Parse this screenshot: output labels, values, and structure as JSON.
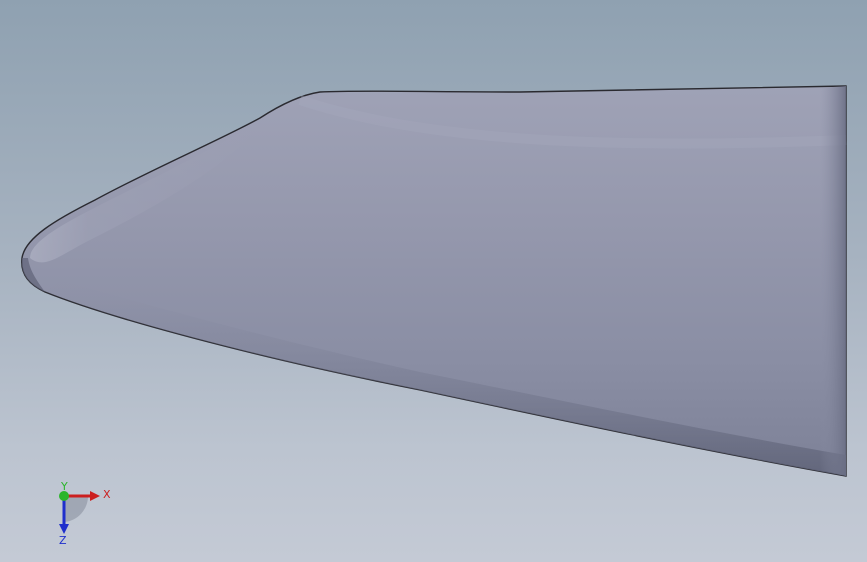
{
  "viewport": {
    "background_top": "#8fa1b1",
    "background_bottom": "#c4cad5"
  },
  "model": {
    "fill_light": "#9da0b5",
    "fill_mid": "#8e92a8",
    "fill_dark": "#6f7389",
    "edge_color": "#2a2a30"
  },
  "triad": {
    "x_label": "X",
    "y_label": "Y",
    "z_label": "Z",
    "x_color": "#cc1f1f",
    "y_color": "#2bb52b",
    "z_color": "#1f2fcc"
  }
}
